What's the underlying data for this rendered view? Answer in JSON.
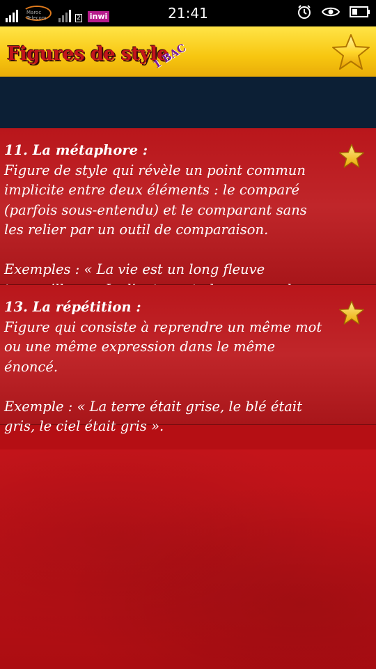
{
  "status": {
    "carrier1": "Maroc Telecom",
    "sim_slot": "2",
    "carrier2": "inwi",
    "time": "21:41"
  },
  "header": {
    "title": "Figures de style",
    "subtitle": "1 BAC",
    "favorite_icon": "star-icon"
  },
  "items": [
    {
      "title": "11. La métaphore :",
      "definition": "Figure de style qui révèle un point commun implicite entre deux éléments : le comparé (parfois sous-entendu) et le comparant sans les relier par un outil de comparaison.",
      "example": "Exemples : « La vie est un long fleuve tranquille ». « Le lieutenant aboya un ordre »"
    },
    {
      "title": "13. La répétition :",
      "definition": "Figure qui consiste à reprendre un même mot ou une même expression dans le même énoncé.",
      "example": "Exemple : « La terre était grise, le blé était gris, le ciel était gris »."
    }
  ],
  "colors": {
    "header_yellow": "#f7c610",
    "title_red": "#c3151b",
    "list_red": "#b9161b",
    "band_navy": "#0c1f35",
    "star_gold": "#f6c221"
  }
}
